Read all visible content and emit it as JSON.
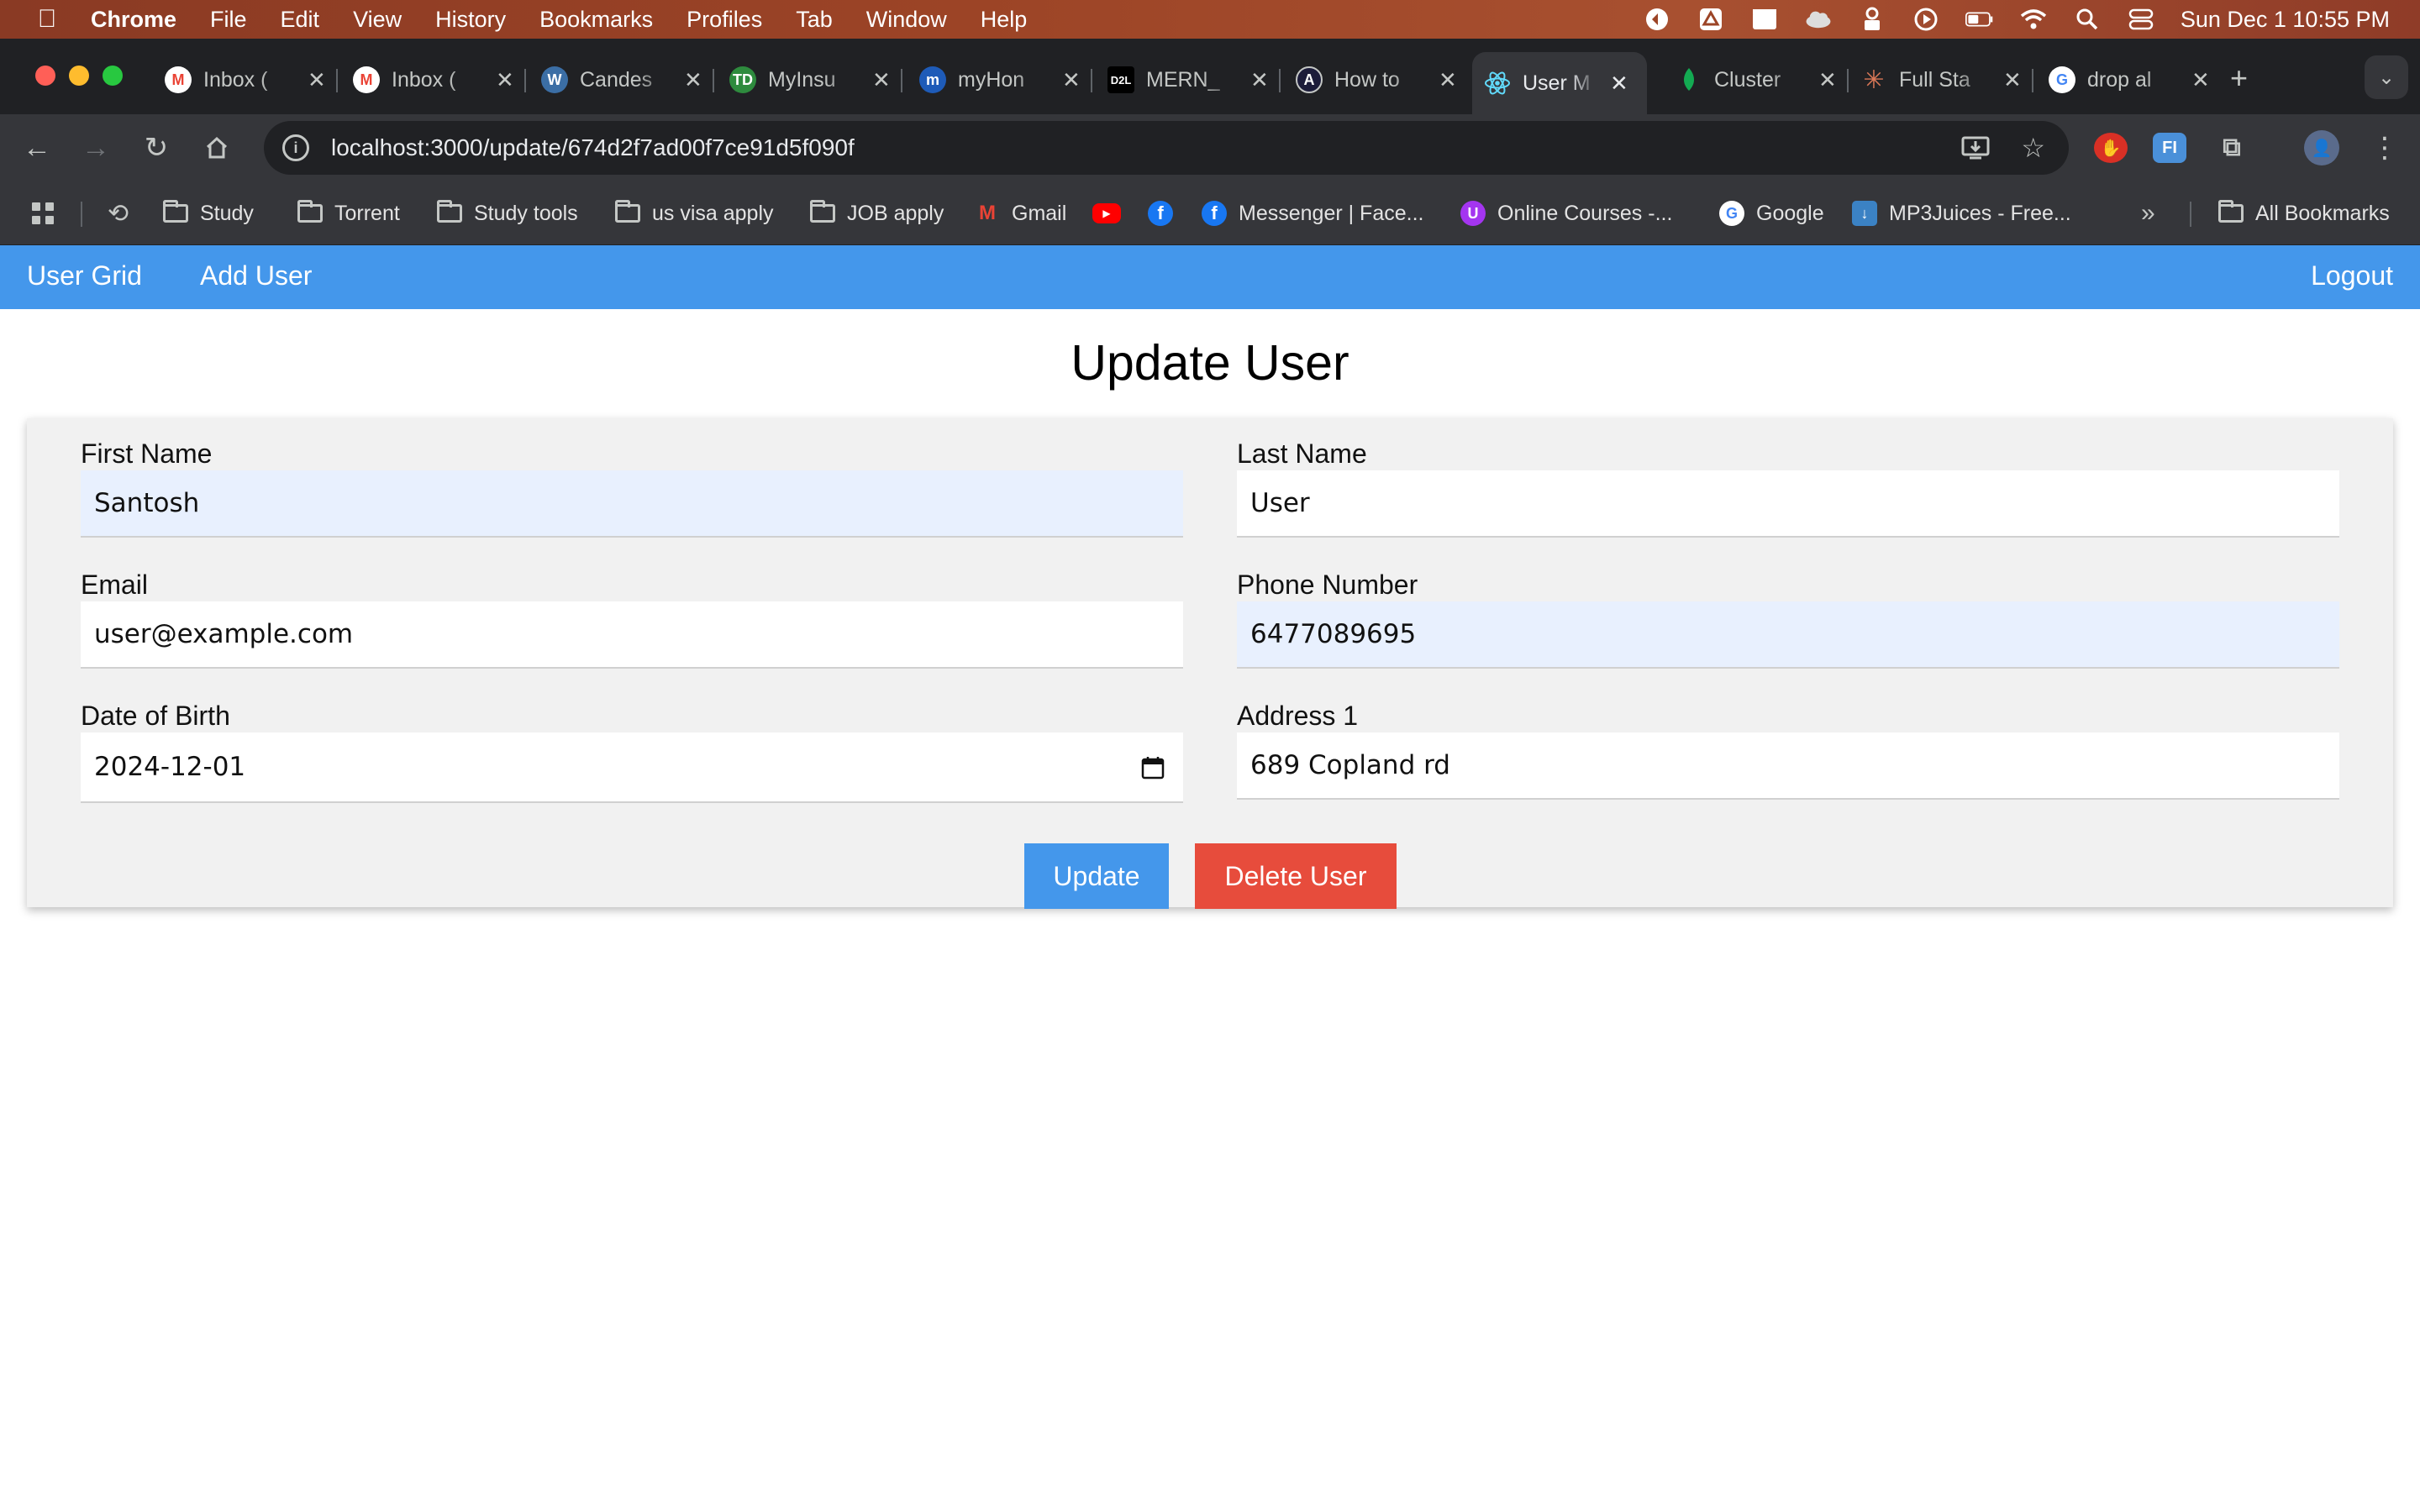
{
  "os_menubar": {
    "app_name": "Chrome",
    "menus": [
      "File",
      "Edit",
      "View",
      "History",
      "Bookmarks",
      "Profiles",
      "Tab",
      "Window",
      "Help"
    ],
    "clock": "Sun Dec 1  10:55 PM"
  },
  "browser": {
    "tabs": [
      {
        "label": "Inbox (",
        "icon": "gmail-icon",
        "color": "#ea4335"
      },
      {
        "label": "Inbox (",
        "icon": "gmail-icon",
        "color": "#ea4335"
      },
      {
        "label": "Candes",
        "icon": "wordpress-icon",
        "color": "#3b6ea5"
      },
      {
        "label": "MyInsu",
        "icon": "td-icon",
        "color": "#2e8b3e"
      },
      {
        "label": "myHon",
        "icon": "myhome-icon",
        "color": "#1e5bb8"
      },
      {
        "label": "MERN_",
        "icon": "d2l-icon",
        "color": "#000000"
      },
      {
        "label": "How to",
        "icon": "ai-icon",
        "color": "#1c1c3a"
      },
      {
        "label": "User M",
        "icon": "react-icon",
        "color": "#61dafb",
        "active": true
      },
      {
        "label": "Cluster",
        "icon": "mongodb-leaf-icon",
        "color": "#13aa52"
      },
      {
        "label": "Full Sta",
        "icon": "claude-icon",
        "color": "#d97757"
      },
      {
        "label": "drop al",
        "icon": "google-icon",
        "color": "#4285f4"
      }
    ],
    "url": "localhost:3000/update/674d2f7ad00f7ce91d5f090f",
    "bookmarks": [
      {
        "label": "Study",
        "type": "folder"
      },
      {
        "label": "Torrent",
        "type": "folder"
      },
      {
        "label": "Study tools",
        "type": "folder"
      },
      {
        "label": "us visa apply",
        "type": "folder"
      },
      {
        "label": "JOB apply",
        "type": "folder"
      },
      {
        "label": "Gmail",
        "type": "link",
        "icon": "gmail-icon"
      },
      {
        "label": "",
        "type": "link",
        "icon": "youtube-icon"
      },
      {
        "label": "",
        "type": "link",
        "icon": "facebook-icon"
      },
      {
        "label": "Messenger | Face...",
        "type": "link",
        "icon": "facebook-icon"
      },
      {
        "label": "Online Courses -...",
        "type": "link",
        "icon": "udemy-icon"
      },
      {
        "label": "Google",
        "type": "link",
        "icon": "google-icon"
      },
      {
        "label": "MP3Juices - Free...",
        "type": "link",
        "icon": "download-icon"
      }
    ],
    "all_bookmarks": "All Bookmarks"
  },
  "app": {
    "nav": {
      "user_grid": "User Grid",
      "add_user": "Add User",
      "logout": "Logout"
    },
    "title": "Update User",
    "form": {
      "first_name_label": "First Name",
      "first_name": "Santosh",
      "last_name_label": "Last Name",
      "last_name": "User",
      "email_label": "Email",
      "email": "user@example.com",
      "phone_label": "Phone Number",
      "phone": "6477089695",
      "dob_label": "Date of Birth",
      "dob": "2024-12-01",
      "address_label": "Address 1",
      "address": "689 Copland rd"
    },
    "buttons": {
      "update": "Update",
      "delete": "Delete User"
    },
    "colors": {
      "nav_bg": "#4497eb",
      "update_btn": "#4497eb",
      "delete_btn": "#e74c3c",
      "autofill_bg": "#e8f0fe"
    }
  }
}
